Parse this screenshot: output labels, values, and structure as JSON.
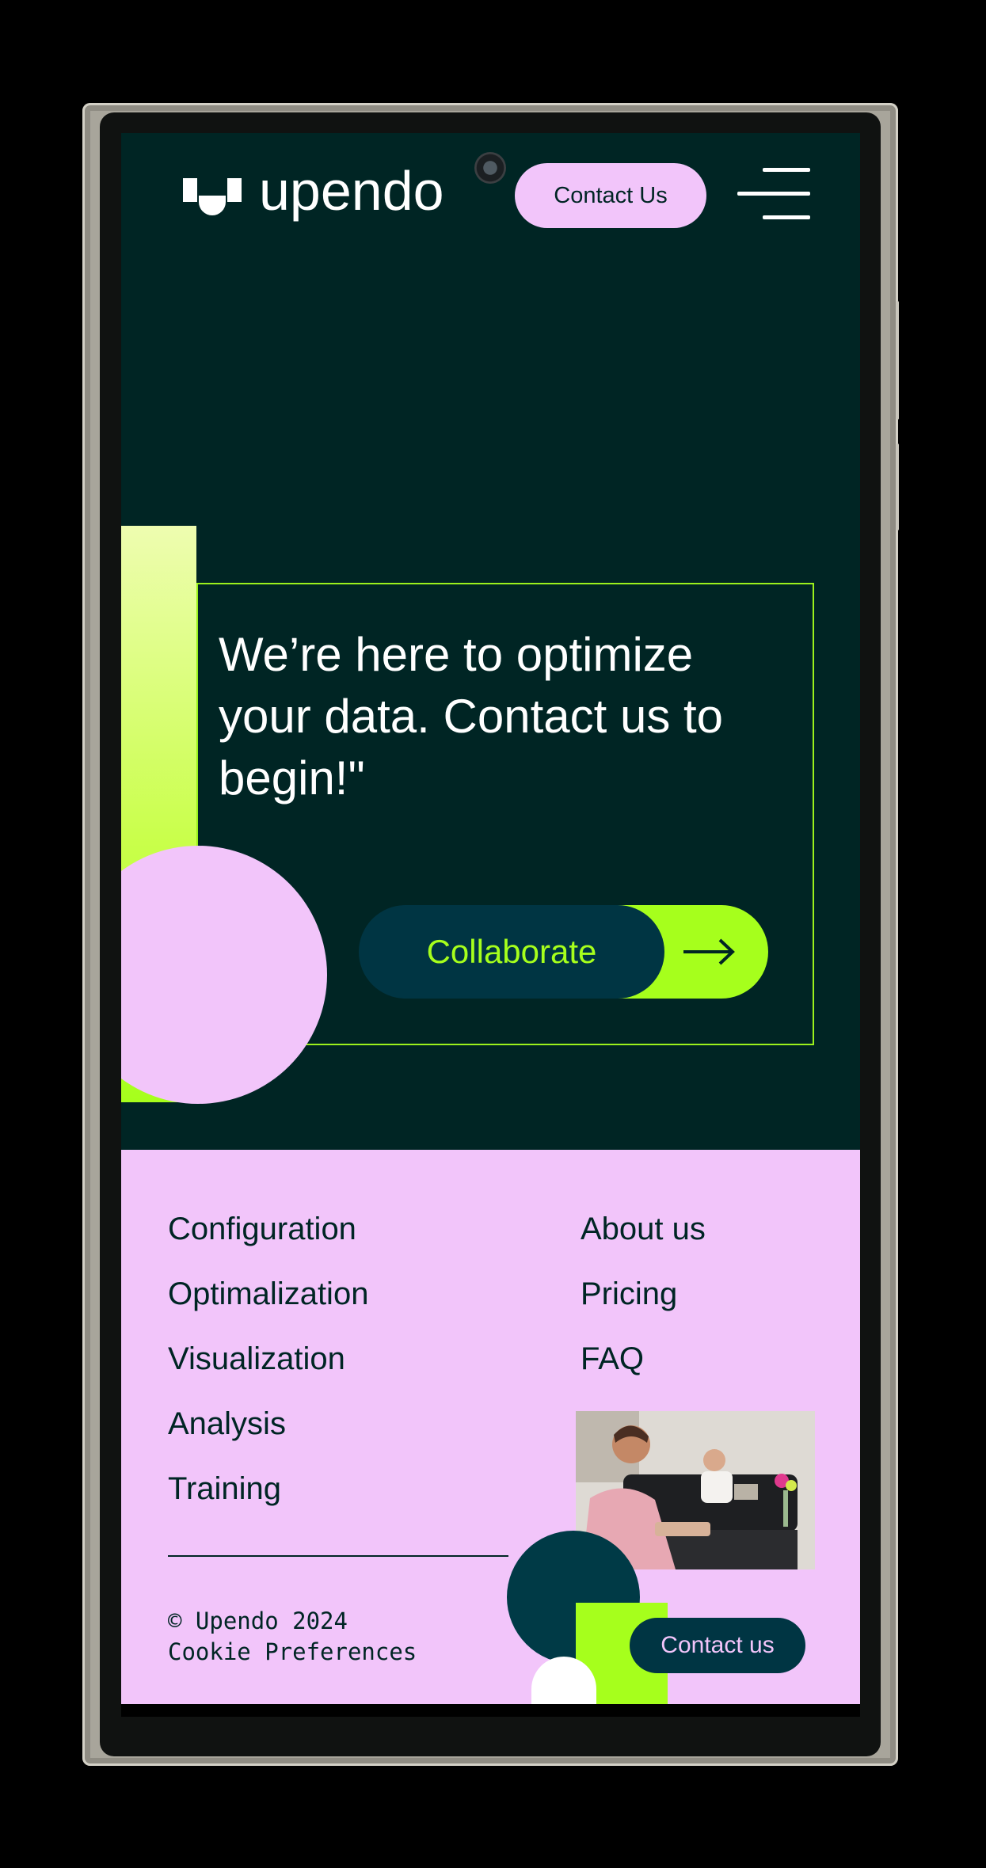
{
  "header": {
    "logo_text": "upendo",
    "contact_label": "Contact Us",
    "menu_icon": "hamburger-menu-icon"
  },
  "hero": {
    "title": "We’re here to optimize your data. Contact us to begin!\"",
    "cta_label": "Collaborate",
    "cta_icon": "arrow-right-icon"
  },
  "footer": {
    "col1": [
      "Configuration",
      "Optimalization",
      "Visualization",
      "Analysis",
      "Training"
    ],
    "col2": [
      "About us",
      "Pricing",
      "FAQ"
    ],
    "copyright": "© Upendo 2024",
    "cookie_label": "Cookie Preferences",
    "contact_label": "Contact us"
  },
  "colors": {
    "hero_bg": "#002524",
    "pink": "#f2c5fa",
    "lime": "#a6ff1c",
    "teal": "#003543",
    "white": "#ffffff"
  }
}
